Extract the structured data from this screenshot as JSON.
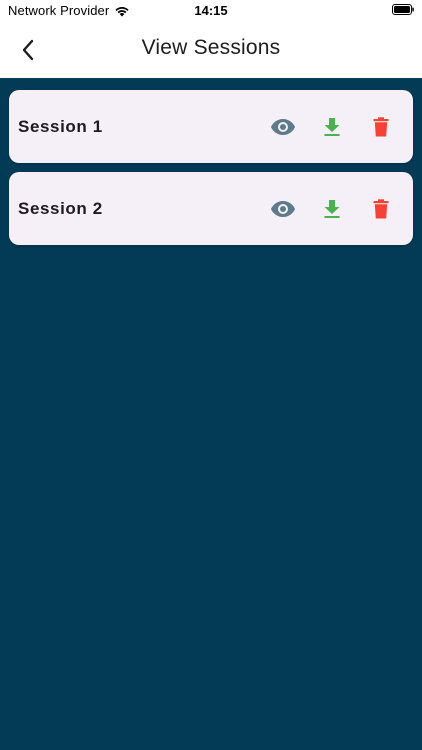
{
  "status_bar": {
    "carrier": "Network Provider",
    "time": "14:15"
  },
  "app_bar": {
    "title": "View Sessions",
    "back_icon": "chevron-left-icon"
  },
  "colors": {
    "background": "#033a56",
    "card": "#f5eff7",
    "view_icon": "#5f7a8a",
    "download_icon": "#4caf50",
    "delete_icon": "#f44336"
  },
  "sessions": [
    {
      "name": "Session 1",
      "actions": [
        "eye-icon",
        "download-icon",
        "trash-icon"
      ]
    },
    {
      "name": "Session 2",
      "actions": [
        "eye-icon",
        "download-icon",
        "trash-icon"
      ]
    }
  ]
}
